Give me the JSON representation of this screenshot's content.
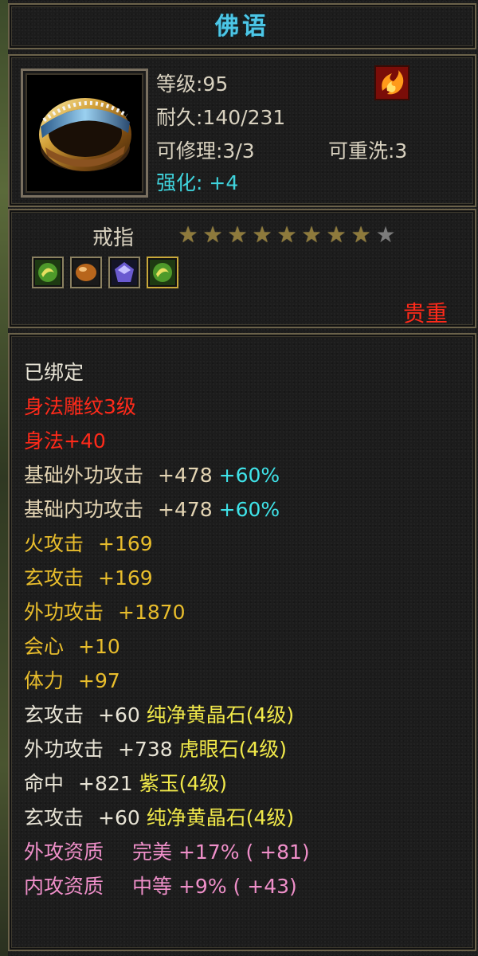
{
  "colors": {
    "title": "#4cc6e6",
    "enhance": "#3fd3dc",
    "rarity": "#ff2a1a",
    "bound": "#e8e4d6",
    "engrave": "#ff2a1a",
    "base": "#e3d4b3",
    "bonus": "#e8bd2c",
    "percent": "#3fe3e9",
    "gem_name": "#f0e84a",
    "quality": "#ef8fc9",
    "star_on": "#8e7a3c",
    "star_off": "#7c7c7c"
  },
  "item": {
    "name": "佛语",
    "icon": "ring-icon",
    "level": "等级:95",
    "durability": "耐久:140/231",
    "repair": "可修理:3/3",
    "rewash": "可重洗:3",
    "enhance": "强化: +4",
    "school_icon": "flame-swirl-icon",
    "type": "戒指",
    "stars": {
      "filled": 8,
      "total": 9
    },
    "gem_slots": [
      {
        "icon": "green-gem-icon",
        "color": "#3e8a2a"
      },
      {
        "icon": "amber-gem-icon",
        "color": "#b8661c"
      },
      {
        "icon": "purple-gem-icon",
        "color": "#6a5ad0"
      },
      {
        "icon": "green-gem-icon",
        "color": "#3e8a2a"
      }
    ],
    "rarity": "贵重"
  },
  "attributes": {
    "bound": "已绑定",
    "engrave_name": "身法雕纹3级",
    "engrave_value": "身法+40",
    "base_rows": [
      {
        "label": "基础外功攻击",
        "value": "+478",
        "percent": "+60%"
      },
      {
        "label": "基础内功攻击",
        "value": "+478",
        "percent": "+60%"
      }
    ],
    "bonus_rows": [
      {
        "label": "火攻击",
        "value": "+169"
      },
      {
        "label": "玄攻击",
        "value": "+169"
      },
      {
        "label": "外功攻击",
        "value": "+1870"
      },
      {
        "label": "会心",
        "value": "+10"
      },
      {
        "label": "体力",
        "value": "+97"
      }
    ],
    "gem_rows": [
      {
        "label": "玄攻击",
        "value": "+60",
        "gem": "纯净黄晶石(4级)"
      },
      {
        "label": "外功攻击",
        "value": "+738",
        "gem": "虎眼石(4级)"
      },
      {
        "label": "命中",
        "value": "+821",
        "gem": "紫玉(4级)"
      },
      {
        "label": "玄攻击",
        "value": "+60",
        "gem": "纯净黄晶石(4级)"
      }
    ],
    "quality_rows": [
      {
        "label": "外攻资质",
        "grade": "完美",
        "value": "+17%",
        "extra": "( +81)"
      },
      {
        "label": "内攻资质",
        "grade": "中等",
        "value": "+9%",
        "extra": "( +43)"
      }
    ]
  }
}
